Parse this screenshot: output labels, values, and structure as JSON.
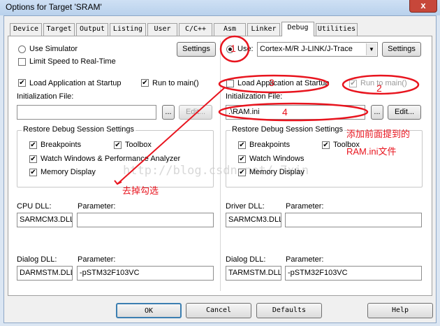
{
  "window": {
    "title": "Options for Target 'SRAM'",
    "close_glyph": "x"
  },
  "tabs": [
    "Device",
    "Target",
    "Output",
    "Listing",
    "User",
    "C/C++",
    "Asm",
    "Linker",
    "Debug",
    "Utilities"
  ],
  "active_tab": "Debug",
  "left": {
    "use_simulator": {
      "label": "Use Simulator",
      "selected": false
    },
    "limit_speed": {
      "label": "Limit Speed to Real-Time",
      "checked": false
    },
    "settings_label": "Settings",
    "load_app": {
      "label": "Load Application at Startup",
      "checked": true
    },
    "run_to_main": {
      "label": "Run to main()",
      "checked": true
    },
    "init_file": {
      "label": "Initialization File:",
      "value": "",
      "browse": "...",
      "edit": "Edit..."
    },
    "restore": {
      "title": "Restore Debug Session Settings",
      "breakpoints": {
        "label": "Breakpoints",
        "checked": true
      },
      "toolbox": {
        "label": "Toolbox",
        "checked": true
      },
      "watch": {
        "label": "Watch Windows & Performance Analyzer",
        "checked": true
      },
      "memory": {
        "label": "Memory Display",
        "checked": true
      }
    },
    "dll": {
      "label": "CPU DLL:",
      "value": "SARMCM3.DLL",
      "param_label": "Parameter:",
      "param_value": ""
    },
    "dialog": {
      "label": "Dialog DLL:",
      "value": "DARMSTM.DLL",
      "param_label": "Parameter:",
      "param_value": "-pSTM32F103VC"
    }
  },
  "right": {
    "use": {
      "label": "Use:",
      "selected": true
    },
    "driver": "Cortex-M/R J-LINK/J-Trace",
    "settings_label": "Settings",
    "load_app": {
      "label": "Load Application at Startup",
      "checked": false
    },
    "run_to_main": {
      "label": "Run to main()",
      "checked": true,
      "disabled": true
    },
    "init_file": {
      "label": "Initialization File:",
      "value": ".\\RAM.ini",
      "browse": "...",
      "edit": "Edit..."
    },
    "restore": {
      "title": "Restore Debug Session Settings",
      "breakpoints": {
        "label": "Breakpoints",
        "checked": true
      },
      "toolbox": {
        "label": "Toolbox",
        "checked": true
      },
      "watch": {
        "label": "Watch Windows",
        "checked": true
      },
      "memory": {
        "label": "Memory Display",
        "checked": true
      }
    },
    "dll": {
      "label": "Driver DLL:",
      "value": "SARMCM3.DLL",
      "param_label": "Parameter:",
      "param_value": ""
    },
    "dialog": {
      "label": "Dialog DLL:",
      "value": "TARMSTM.DLL",
      "param_label": "Parameter:",
      "param_value": "-pSTM32F103VC"
    }
  },
  "buttons": {
    "ok": "OK",
    "cancel": "Cancel",
    "defaults": "Defaults",
    "help": "Help"
  },
  "annotations": {
    "n1": "1",
    "n2": "2",
    "n3": "3",
    "n4": "4",
    "uncheck_note": "去掉勾选",
    "add_note_line1": "添加前面提到的",
    "add_note_line2": "RAM.ini文件",
    "watermark": "http://blog.csdn.net/          7xin",
    "color": "#e8141e"
  },
  "check_glyph": "✔"
}
